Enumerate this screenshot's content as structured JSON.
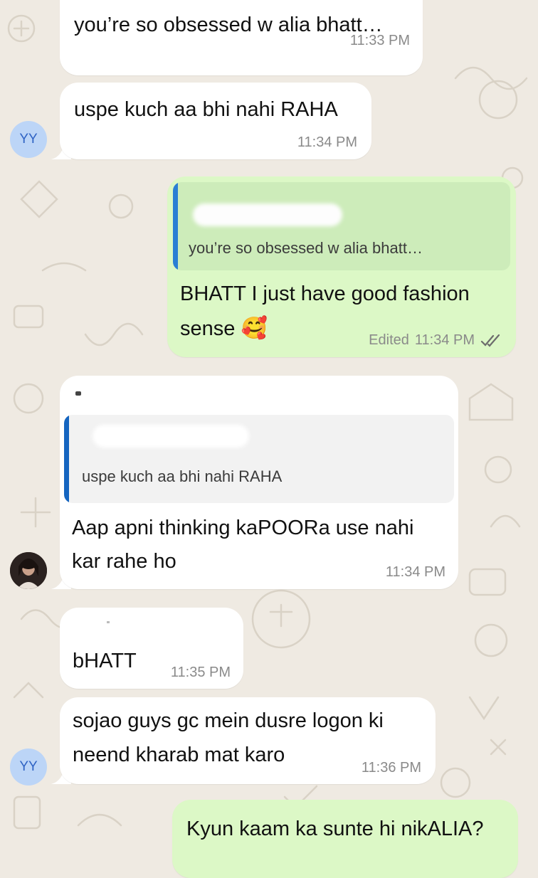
{
  "colors": {
    "background": "#efeae2",
    "incoming_bubble": "#ffffff",
    "outgoing_bubble": "#dcf8c6",
    "reply_bar_outgoing": "#2a7fd4",
    "reply_bar_incoming": "#1565c0",
    "read_ticks": "#6c6c6c"
  },
  "messages": [
    {
      "text": "you’re so obsessed w alia bhatt…",
      "time": "11:33 PM"
    },
    {
      "sender": "YY",
      "text": "uspe kuch aa bhi nahi RAHA",
      "time": "11:34 PM"
    },
    {
      "quote": "you’re so obsessed w alia bhatt…",
      "line1": "BHATT I just have good fashion",
      "line2": "sense",
      "emoji": "🥰",
      "edited": "Edited",
      "time": "11:34 PM",
      "status_icon": "double-check-icon"
    },
    {
      "sender_icon": "profile-photo",
      "quote": "uspe kuch aa bhi nahi RAHA",
      "line1": "Aap apni thinking kaPOORa use nahi",
      "line2": "kar rahe ho",
      "time": "11:34 PM"
    },
    {
      "text": "bHATT",
      "time": "11:35 PM"
    },
    {
      "sender": "YY",
      "line1": "sojao guys gc mein dusre logon ki",
      "line2": "neend kharab mat karo",
      "time": "11:36 PM"
    },
    {
      "text": "Kyun kaam ka sunte hi nikALIA?"
    }
  ]
}
